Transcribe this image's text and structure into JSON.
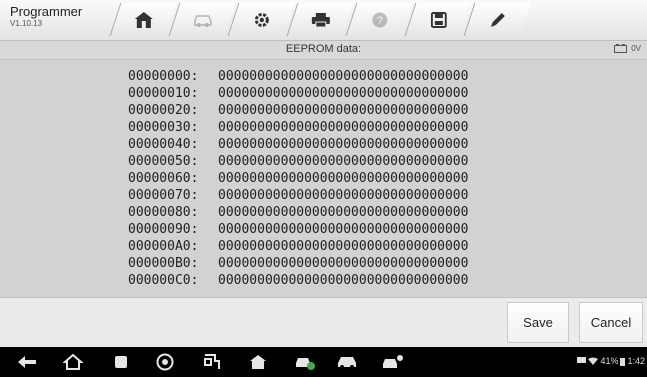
{
  "app": {
    "name": "Programmer",
    "version": "V1.10.13"
  },
  "toolbar": {
    "buttons": [
      {
        "icon": "home-icon",
        "enabled": true
      },
      {
        "icon": "vehicle-swap-icon",
        "enabled": false
      },
      {
        "icon": "gear-icon",
        "enabled": true
      },
      {
        "icon": "printer-icon",
        "enabled": true
      },
      {
        "icon": "help-icon",
        "enabled": false
      },
      {
        "icon": "save-icon",
        "enabled": true
      },
      {
        "icon": "pen-icon",
        "enabled": true
      }
    ]
  },
  "info": {
    "title": "EEPROM data:",
    "battery_voltage": "0V"
  },
  "hex_rows": [
    {
      "address": "00000000:",
      "data": "00000000000000000000000000000000"
    },
    {
      "address": "00000010:",
      "data": "00000000000000000000000000000000"
    },
    {
      "address": "00000020:",
      "data": "00000000000000000000000000000000"
    },
    {
      "address": "00000030:",
      "data": "00000000000000000000000000000000"
    },
    {
      "address": "00000040:",
      "data": "00000000000000000000000000000000"
    },
    {
      "address": "00000050:",
      "data": "00000000000000000000000000000000"
    },
    {
      "address": "00000060:",
      "data": "00000000000000000000000000000000"
    },
    {
      "address": "00000070:",
      "data": "00000000000000000000000000000000"
    },
    {
      "address": "00000080:",
      "data": "00000000000000000000000000000000"
    },
    {
      "address": "00000090:",
      "data": "00000000000000000000000000000000"
    },
    {
      "address": "000000A0:",
      "data": "00000000000000000000000000000000"
    },
    {
      "address": "000000B0:",
      "data": "00000000000000000000000000000000"
    },
    {
      "address": "000000C0:",
      "data": "00000000000000000000000000000000"
    }
  ],
  "footer": {
    "save_label": "Save",
    "cancel_label": "Cancel"
  },
  "status_bar": {
    "battery_percent": "41%",
    "time": "1:42"
  },
  "colors": {
    "accent_green": "#3cb043",
    "nav_background": "#000000"
  }
}
